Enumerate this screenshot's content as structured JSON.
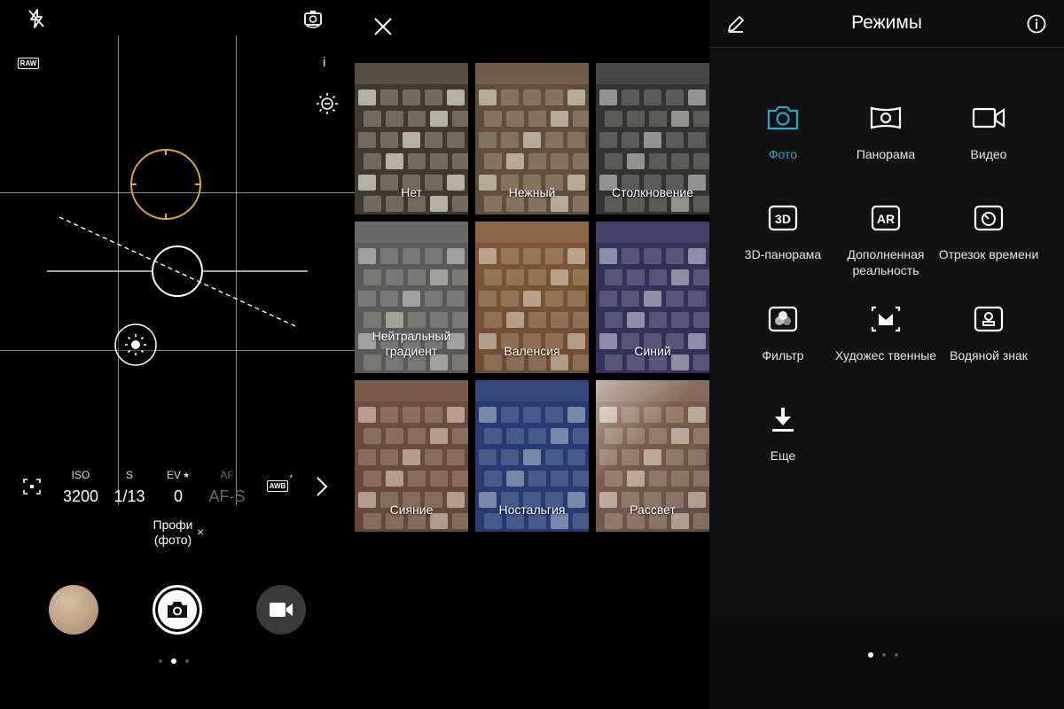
{
  "pro": {
    "params": [
      {
        "label": "ISO",
        "value": "3200",
        "starred": false,
        "dim": false
      },
      {
        "label": "S",
        "value": "1/13",
        "starred": false,
        "dim": false
      },
      {
        "label": "EV",
        "value": "0",
        "starred": true,
        "dim": false
      },
      {
        "label": "AF",
        "value": "AF-S",
        "starred": false,
        "dim": true
      }
    ],
    "awb_label": "AWB",
    "raw_label": "RAW",
    "info_label": "i",
    "mode_name": "Профи\n(фото)",
    "mode_close": "×",
    "icons": {
      "flash": "flash-off-icon",
      "switch_camera": "switch-camera-icon",
      "metering": "metering-icon",
      "exposure": "exposure-icon",
      "more": "chevron-right-icon"
    },
    "accent_ring": "#e2a72e"
  },
  "filters": {
    "close_icon": "close-icon",
    "items": [
      {
        "name": "Нет",
        "selected": false
      },
      {
        "name": "Нежный",
        "selected": false
      },
      {
        "name": "Столкновение",
        "selected": false
      },
      {
        "name": "Нейтральный градиент",
        "selected": false
      },
      {
        "name": "Валенсия",
        "selected": true
      },
      {
        "name": "Синий",
        "selected": false
      },
      {
        "name": "Сияние",
        "selected": false
      },
      {
        "name": "Ностальгия",
        "selected": false
      },
      {
        "name": "Рассвет",
        "selected": false
      }
    ],
    "selected_color": "#2aa7c9"
  },
  "modes": {
    "title": "Режимы",
    "edit_icon": "pencil-icon",
    "info_icon": "info-icon",
    "accent": "#2aa7c9",
    "items": [
      {
        "label": "Фото",
        "icon": "camera-icon",
        "active": true
      },
      {
        "label": "Панорама",
        "icon": "panorama-icon",
        "active": false
      },
      {
        "label": "Видео",
        "icon": "video-icon",
        "active": false
      },
      {
        "label": "3D-панорама",
        "icon": "3d-panorama-icon",
        "active": false
      },
      {
        "label": "Дополненная реальность",
        "icon": "ar-icon",
        "active": false
      },
      {
        "label": "Отрезок времени",
        "icon": "timelapse-icon",
        "active": false
      },
      {
        "label": "Фильтр",
        "icon": "filter-icon",
        "active": false
      },
      {
        "label": "Художес твенные",
        "icon": "artist-icon",
        "active": false
      },
      {
        "label": "Водяной знак",
        "icon": "watermark-icon",
        "active": false
      },
      {
        "label": "Еще",
        "icon": "download-icon",
        "active": false
      }
    ]
  }
}
